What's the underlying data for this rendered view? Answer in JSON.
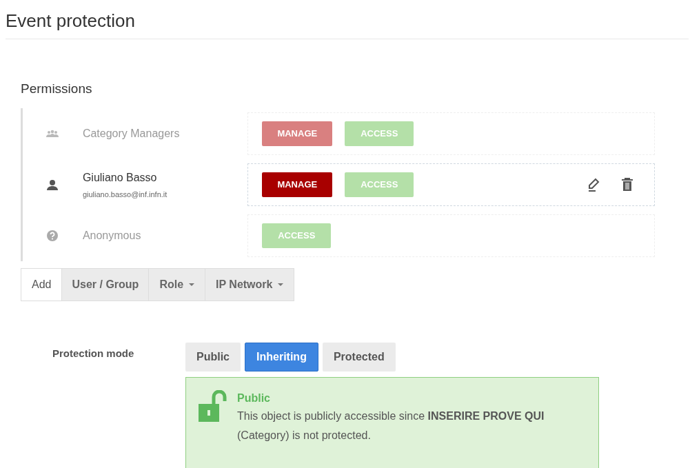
{
  "title": "Event protection",
  "permissions": {
    "heading": "Permissions",
    "entries": [
      {
        "kind": "group",
        "name": "Category Managers",
        "inherited": true,
        "editable": false,
        "roles": [
          {
            "kind": "manage",
            "label": "MANAGE",
            "active": false
          },
          {
            "kind": "access",
            "label": "ACCESS",
            "active": false
          }
        ]
      },
      {
        "kind": "user",
        "name": "Giuliano Basso",
        "email": "giuliano.basso@inf.infn.it",
        "inherited": false,
        "editable": true,
        "roles": [
          {
            "kind": "manage",
            "label": "MANAGE",
            "active": true
          },
          {
            "kind": "access",
            "label": "ACCESS",
            "active": false
          }
        ]
      },
      {
        "kind": "anonymous",
        "name": "Anonymous",
        "inherited": true,
        "editable": false,
        "roles": [
          {
            "kind": "access",
            "label": "ACCESS",
            "active": false
          }
        ]
      }
    ],
    "add_bar": [
      {
        "kind": "label",
        "label": "Add"
      },
      {
        "kind": "button",
        "label": "User / Group"
      },
      {
        "kind": "dropdown",
        "label": "Role"
      },
      {
        "kind": "dropdown",
        "label": "IP Network"
      }
    ]
  },
  "protection": {
    "label": "Protection mode",
    "modes": [
      {
        "label": "Public",
        "selected": false
      },
      {
        "label": "Inheriting",
        "selected": true
      },
      {
        "label": "Protected",
        "selected": false
      }
    ],
    "alert": {
      "title": "Public",
      "message": "This object is publicly accessible since **INSERIRE PROVE QUI** (Category) is not protected."
    }
  }
}
